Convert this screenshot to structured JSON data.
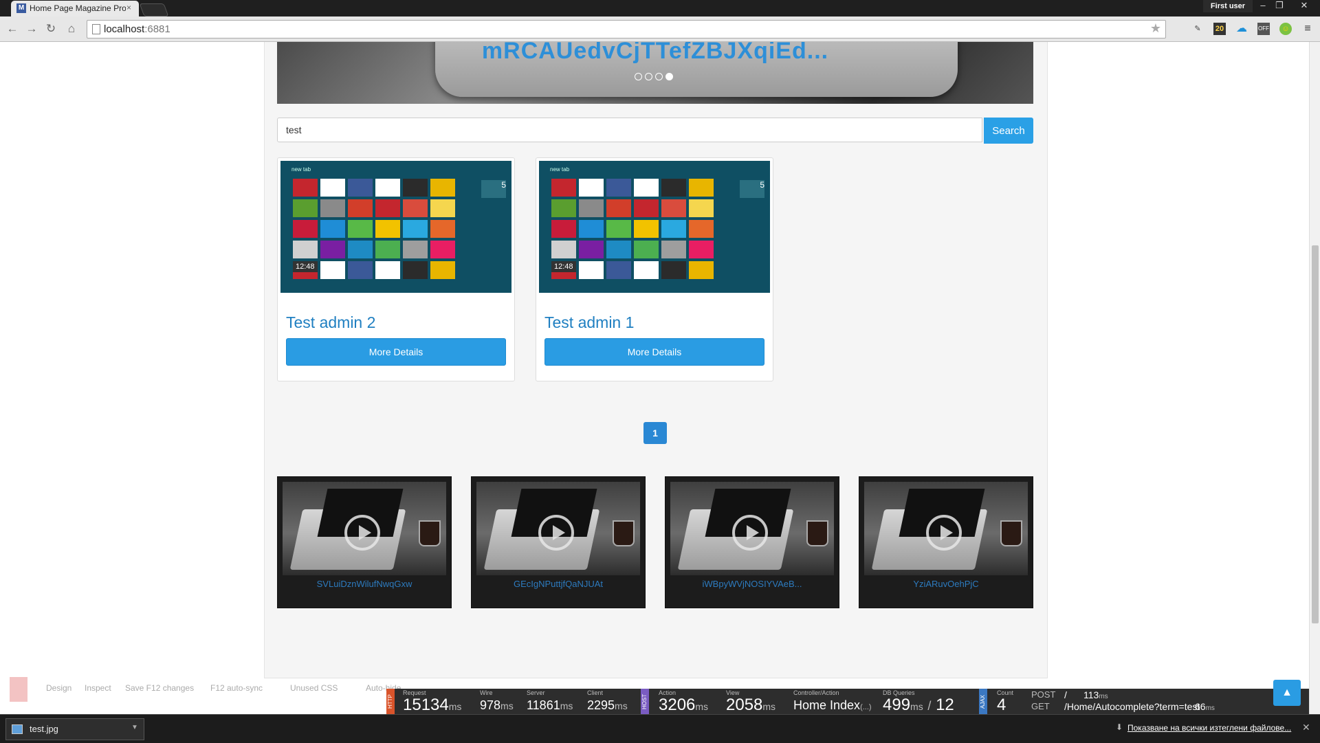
{
  "browser": {
    "tab_title": "Home Page Magazine Pro",
    "tab_favicon": "M",
    "tab_close": "×",
    "user_badge": "First user",
    "window_controls": [
      "–",
      "❐",
      "✕"
    ],
    "url_host": "localhost",
    "url_port": ":6881",
    "extension_badge": "20",
    "extension_off_label": "OFF"
  },
  "hero": {
    "title": "mRCAUedvCjTTefZBJXqiEd...",
    "slides": 4,
    "active_slide": 4
  },
  "search": {
    "value": "test",
    "button_label": "Search"
  },
  "results": [
    {
      "title": "Test admin 2",
      "button_label": "More Details"
    },
    {
      "title": "Test admin 1",
      "button_label": "More Details"
    }
  ],
  "tile_screenshot": {
    "new_tab_label": "new tab",
    "clock": "12:48",
    "number_tile": "5"
  },
  "pagination": {
    "current": "1"
  },
  "videos": [
    {
      "title": "SVLuiDznWilufNwqGxw"
    },
    {
      "title": "GEcIgNPuttjfQaNJUAt"
    },
    {
      "title": "iWBpyWVjNOSIYVAeB..."
    },
    {
      "title": "YziARuvOehPjC"
    }
  ],
  "browserlink_bar": {
    "items": [
      "Design",
      "Inspect",
      "Save F12 changes",
      "F12 auto-sync",
      "Unused CSS",
      "Auto-hide"
    ]
  },
  "glimpse": {
    "request_label": "Request",
    "request_value": "15134",
    "wire_label": "Wire",
    "wire_value": "978",
    "server_label": "Server",
    "server_value": "11861",
    "client_label": "Client",
    "client_value": "2295",
    "ms": "ms",
    "action_label": "Action",
    "action_value": "3206",
    "view_label": "View",
    "view_value": "2058",
    "controller_label": "Controller/Action",
    "controller_value": "Home Index",
    "controller_suffix": "(...)",
    "db_label": "DB Queries",
    "db_value": "499",
    "db_ms": "ms",
    "db_slash": "/",
    "db_count": "12",
    "count_label": "Count",
    "count_value": "4",
    "post": "POST",
    "get": "GET",
    "slash": "/",
    "ajax_ms": "113",
    "ajax_url": "/Home/Autocomplete?term=test",
    "ajax_time": "66",
    "tag_http": "HTTP",
    "tag_host": "HOST",
    "tag_ajax": "AJAX"
  },
  "downloads": {
    "file_name": "test.jpg",
    "show_all": "Показване на всички изтеглени файлове..."
  }
}
